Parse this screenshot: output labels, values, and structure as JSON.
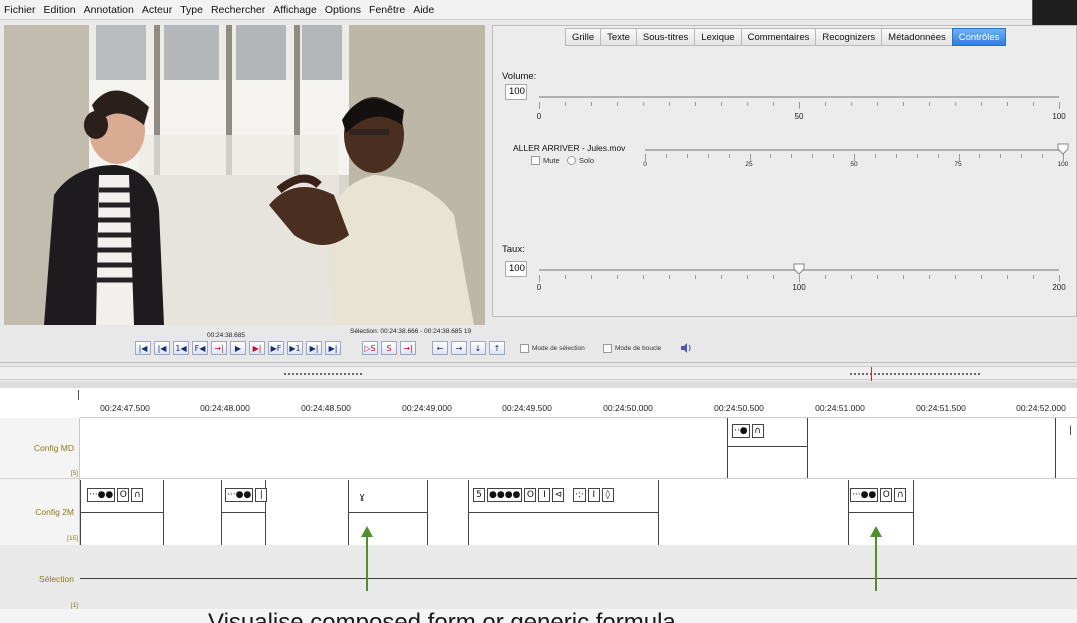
{
  "menu": [
    "Fichier",
    "Edition",
    "Annotation",
    "Acteur",
    "Type",
    "Rechercher",
    "Affichage",
    "Options",
    "Fenêtre",
    "Aide"
  ],
  "tabs": [
    "Grille",
    "Texte",
    "Sous-titres",
    "Lexique",
    "Commentaires",
    "Recognizers",
    "Métadonnées",
    "Contrôles"
  ],
  "active_tab": "Contrôles",
  "volume": {
    "label": "Volume:",
    "value": "100",
    "scale_labels": [
      "0",
      "50",
      "100"
    ],
    "level_percent": 100
  },
  "media": {
    "file": "ALLER ARRIVER - Jules.mov",
    "mute_label": "Mute",
    "solo_label": "Solo",
    "scale_labels": [
      "0",
      "25",
      "50",
      "75",
      "100"
    ],
    "level_percent": 100
  },
  "rate": {
    "label": "Taux:",
    "value": "100",
    "scale_labels": [
      "0",
      "100",
      "200"
    ],
    "level": 100
  },
  "transport": {
    "time": "00:24:38.685",
    "selection": "Sélection: 00:24:38.666 - 00:24:38.685  19",
    "buttons": [
      "|◀",
      "|◀",
      "1◀",
      "F◀",
      "→|",
      "▶",
      "▶|",
      "▶F",
      "▶1",
      "▶|",
      "▶|"
    ],
    "sel_buttons": [
      "▷S",
      "S",
      "→|"
    ],
    "nav_buttons": [
      "←",
      "→",
      "↓",
      "↑"
    ],
    "selection_mode": "Mode de sélection",
    "loop_mode": "Mode de boucle",
    "speaker_icon": "speaker-icon"
  },
  "ruler": [
    "00:24:47.500",
    "00:24:48.000",
    "00:24:48.500",
    "00:24:49.000",
    "00:24:49.500",
    "00:24:50.000",
    "00:24:50.500",
    "00:24:51.000",
    "00:24:51.500",
    "00:24:52.000"
  ],
  "tiers": [
    {
      "name": "Config MD",
      "count": "[5]"
    },
    {
      "name": "Config 2M",
      "count": "[15]"
    },
    {
      "name": "Sélection",
      "count": "[1]"
    }
  ],
  "annotations": {
    "md": [
      [
        "··●",
        "∩"
      ]
    ],
    "two_m": [
      [
        "···●●",
        "O",
        "∩"
      ],
      [
        "···●●",
        "|"
      ],
      [
        "ɣ"
      ],
      [
        "5",
        "●●●●",
        "O",
        "I",
        "⊲"
      ],
      [
        "·:·",
        "I",
        "◊"
      ],
      [
        "···●●",
        "O",
        "∩"
      ]
    ]
  },
  "caption": "Visualise composed form or generic formula",
  "colors": {
    "active_tab": "#2f7fe0",
    "tier_label": "#8a7a18",
    "arrow": "#4e8f2e",
    "overlay": "#1f1f1f"
  }
}
